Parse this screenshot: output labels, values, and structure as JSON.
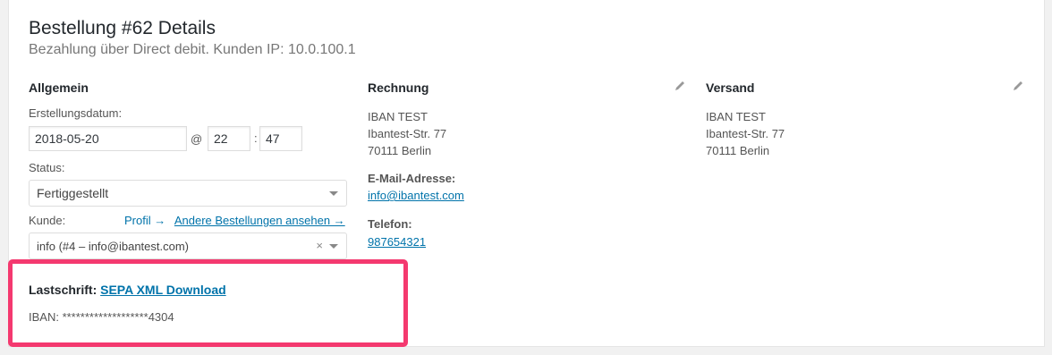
{
  "order": {
    "title": "Bestellung #62 Details",
    "subtitle": "Bezahlung über Direct debit. Kunden IP: 10.0.100.1"
  },
  "general": {
    "heading": "Allgemein",
    "created_label": "Erstellungsdatum:",
    "date_value": "2018-05-20",
    "at_symbol": "@",
    "hour_value": "22",
    "colon": ":",
    "minute_value": "47",
    "status_label": "Status:",
    "status_value": "Fertiggestellt",
    "customer_label": "Kunde:",
    "profile_link": "Profil →",
    "other_orders_link": "Andere Bestellungen ansehen →",
    "customer_value": "info (#4 – info@ibantest.com)",
    "clear_symbol": "×"
  },
  "billing": {
    "heading": "Rechnung",
    "address": [
      "IBAN TEST",
      "Ibantest-Str. 77",
      "70111 Berlin"
    ],
    "email_label": "E-Mail-Adresse:",
    "email_value": "info@ibantest.com",
    "phone_label": "Telefon:",
    "phone_value": "987654321"
  },
  "shipping": {
    "heading": "Versand",
    "address": [
      "IBAN TEST",
      "Ibantest-Str. 77",
      "70111 Berlin"
    ]
  },
  "direct_debit": {
    "label": "Lastschrift:",
    "download_link": "SEPA XML Download",
    "iban_text": "IBAN: *******************4304",
    "highlight_color": "#f4396f"
  },
  "colors": {
    "link": "#0073aa",
    "panel_bg": "#ffffff",
    "page_bg": "#f1f1f1"
  }
}
